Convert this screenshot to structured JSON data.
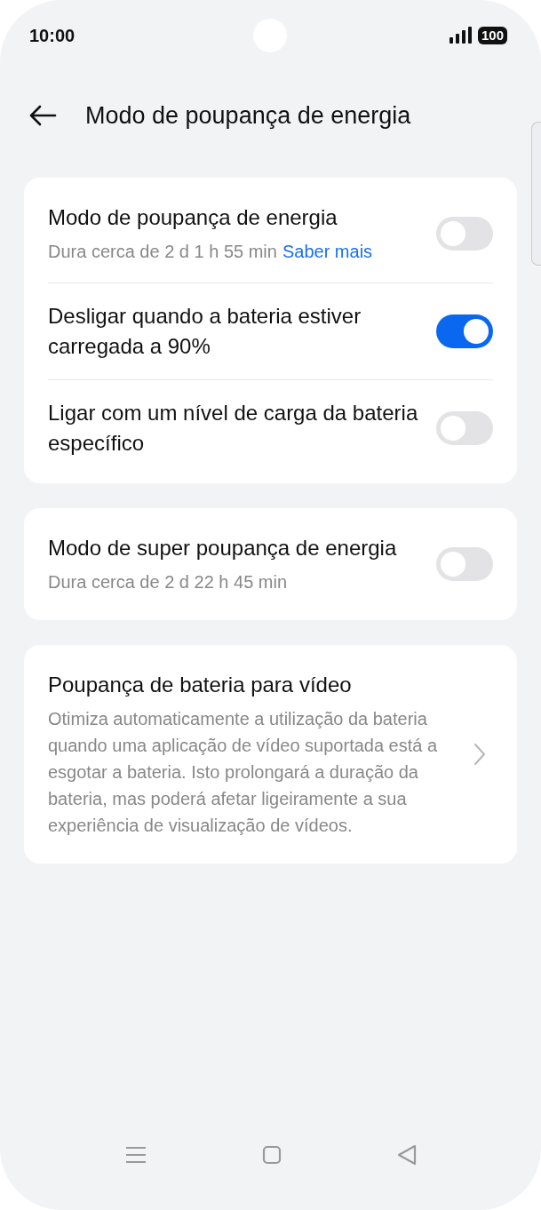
{
  "status_bar": {
    "time": "10:00",
    "battery": "100"
  },
  "header": {
    "title": "Modo de poupança de energia"
  },
  "cards": [
    {
      "rows": [
        {
          "kind": "toggle",
          "title": "Modo de poupança de energia",
          "subtitle": "Dura cerca de 2 d 1 h 55 min",
          "link": "Saber mais",
          "on": false
        },
        {
          "kind": "toggle",
          "title": "Desligar quando a bateria estiver carregada a 90%",
          "on": true
        },
        {
          "kind": "toggle",
          "title": "Ligar com um nível de carga da bateria específico",
          "on": false
        }
      ]
    },
    {
      "rows": [
        {
          "kind": "toggle",
          "title": "Modo de super poupança de energia",
          "subtitle": "Dura cerca de 2 d 22 h 45 min",
          "on": false
        }
      ]
    },
    {
      "rows": [
        {
          "kind": "link",
          "title": "Poupança de bateria para vídeo",
          "subtitle": "Otimiza automaticamente a utilização da bateria quando uma aplicação de vídeo suportada está a esgotar a bateria. Isto prolongará a duração da bateria, mas poderá afetar ligeiramente a sua experiência de visualização de vídeos."
        }
      ]
    }
  ]
}
